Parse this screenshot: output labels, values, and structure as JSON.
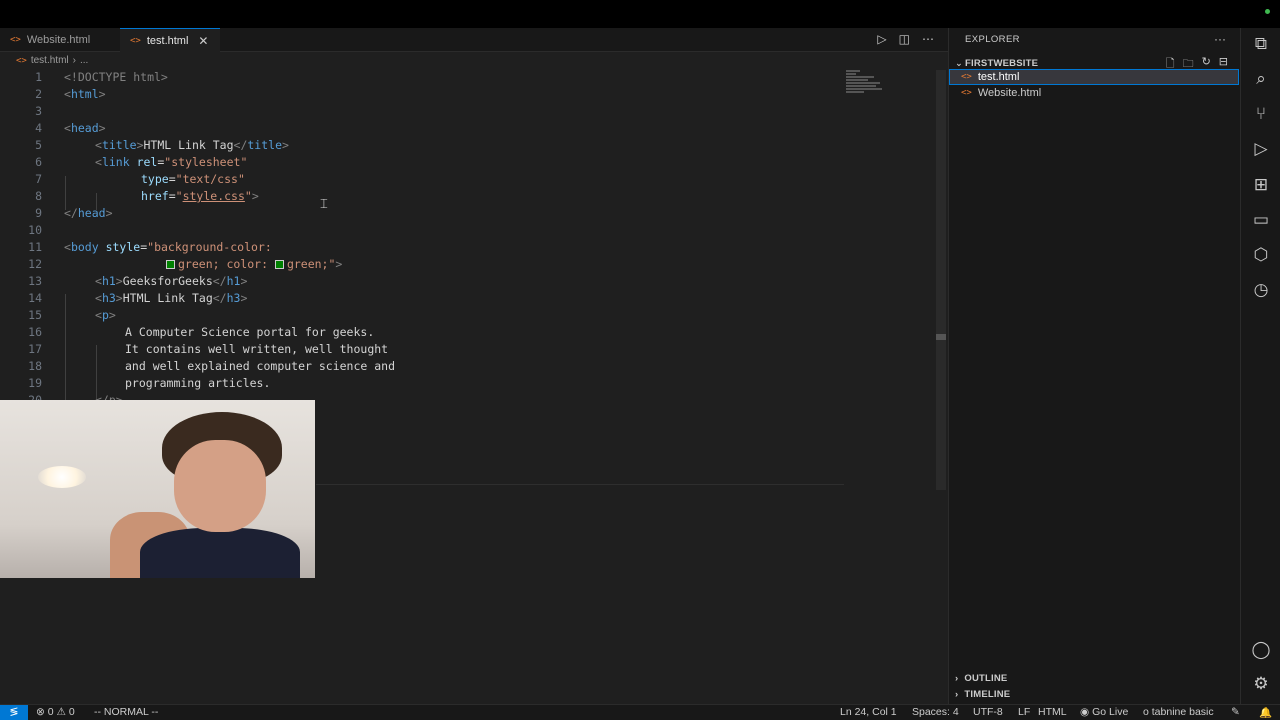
{
  "tabs": [
    {
      "icon": "<>",
      "label": "Website.html",
      "active": false
    },
    {
      "icon": "<>",
      "label": "test.html",
      "active": true,
      "close": "✕"
    }
  ],
  "breadcrumb": {
    "file": "test.html",
    "sep": "›",
    "more": "..."
  },
  "editor": {
    "lines": [
      {
        "n": "1"
      },
      {
        "n": "2"
      },
      {
        "n": "3"
      },
      {
        "n": "4"
      },
      {
        "n": "5"
      },
      {
        "n": "6"
      },
      {
        "n": "7"
      },
      {
        "n": "8"
      },
      {
        "n": "9"
      },
      {
        "n": "10"
      },
      {
        "n": "11"
      },
      {
        "n": "12"
      },
      {
        "n": "13"
      },
      {
        "n": "14"
      },
      {
        "n": "15"
      },
      {
        "n": "16"
      },
      {
        "n": "17"
      },
      {
        "n": "18"
      },
      {
        "n": "19"
      },
      {
        "n": "20"
      }
    ],
    "code": {
      "l1": "<!DOCTYPE html>",
      "l2_tag": "html",
      "l4_tag": "head",
      "l5_open": "title",
      "l5_text": "HTML Link Tag",
      "l5_close": "title",
      "l6_tag": "link",
      "l6_attr": "rel",
      "l6_val": "\"stylesheet\"",
      "l7_attr": "type",
      "l7_val": "\"text/css\"",
      "l8_attr": "href",
      "l8_q1": "\"",
      "l8_val": "style.css",
      "l8_q2": "\"",
      "l9_tag": "head",
      "l11_tag": "body",
      "l11_attr": "style",
      "l11_val": "\"background-color:",
      "l12_a": "green; color: ",
      "l12_b": "green;\"",
      "l13_tag": "h1",
      "l13_text": "GeeksforGeeks",
      "l14_tag": "h3",
      "l14_text": "HTML Link Tag",
      "l15_tag": "p",
      "l16": "A Computer Science portal for geeks.",
      "l17": "It contains well written, well thought",
      "l18": "and well explained computer science and",
      "l19": "programming articles.",
      "l20": "</p>"
    }
  },
  "explorer": {
    "title": "EXPLORER",
    "more": "···",
    "folder": "FIRSTWEBSITE",
    "files": [
      {
        "label": "test.html",
        "selected": true
      },
      {
        "label": "Website.html",
        "selected": false
      }
    ],
    "outline": "OUTLINE",
    "timeline": "TIMELINE"
  },
  "status": {
    "errors": "0",
    "warnings": "0",
    "mode": "-- NORMAL --",
    "position": "Ln 24, Col 1",
    "spaces": "Spaces: 4",
    "encoding": "UTF-8",
    "eol": "LF",
    "language": "HTML",
    "golive": "Go Live",
    "tabnine": "tabnine basic"
  },
  "colors": {
    "accent": "#0078d4",
    "html_icon": "#e37933",
    "color_swatch": "#008000"
  }
}
